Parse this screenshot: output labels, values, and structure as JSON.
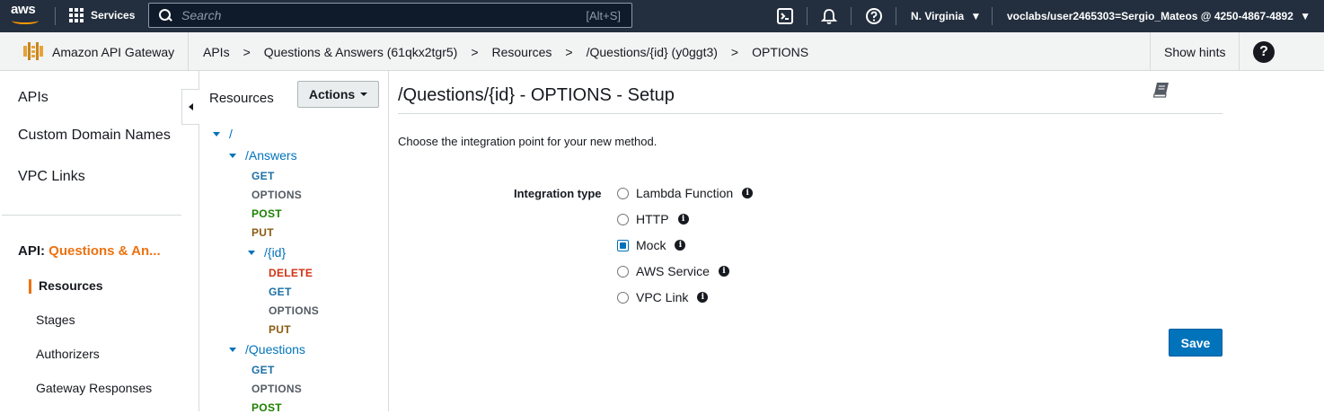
{
  "topnav": {
    "logo_text": "aws",
    "services_label": "Services",
    "search_placeholder": "Search",
    "search_shortcut": "[Alt+S]",
    "region": "N. Virginia",
    "account": "voclabs/user2465303=Sergio_Mateos @ 4250-4867-4892",
    "colors": {
      "bg": "#232f3e",
      "accent": "#ff9900"
    }
  },
  "service": {
    "name": "Amazon API Gateway",
    "show_hints": "Show hints"
  },
  "breadcrumb": [
    "APIs",
    "Questions & Answers (61qkx2tgr5)",
    "Resources",
    "/Questions/{id} (y0ggt3)",
    "OPTIONS"
  ],
  "sidebar": {
    "links": [
      "APIs",
      "Custom Domain Names",
      "VPC Links"
    ],
    "api_prefix": "API:",
    "api_name": "Questions & An...",
    "sub_items": [
      "Resources",
      "Stages",
      "Authorizers",
      "Gateway Responses"
    ],
    "active": "Resources"
  },
  "tree": {
    "title": "Resources",
    "actions_label": "Actions",
    "nodes": {
      "root": "/",
      "answers": "/Answers",
      "answers_id": "/{id}",
      "questions": "/Questions"
    },
    "answers_methods": [
      "GET",
      "OPTIONS",
      "POST",
      "PUT"
    ],
    "answers_id_methods": [
      "DELETE",
      "GET",
      "OPTIONS",
      "PUT"
    ],
    "questions_methods": [
      "GET",
      "OPTIONS",
      "POST"
    ]
  },
  "main": {
    "title": "/Questions/{id} - OPTIONS - Setup",
    "intro": "Choose the integration point for your new method.",
    "integration_label": "Integration type",
    "options": [
      "Lambda Function",
      "HTTP",
      "Mock",
      "AWS Service",
      "VPC Link"
    ],
    "selected": "Mock",
    "save_label": "Save"
  }
}
